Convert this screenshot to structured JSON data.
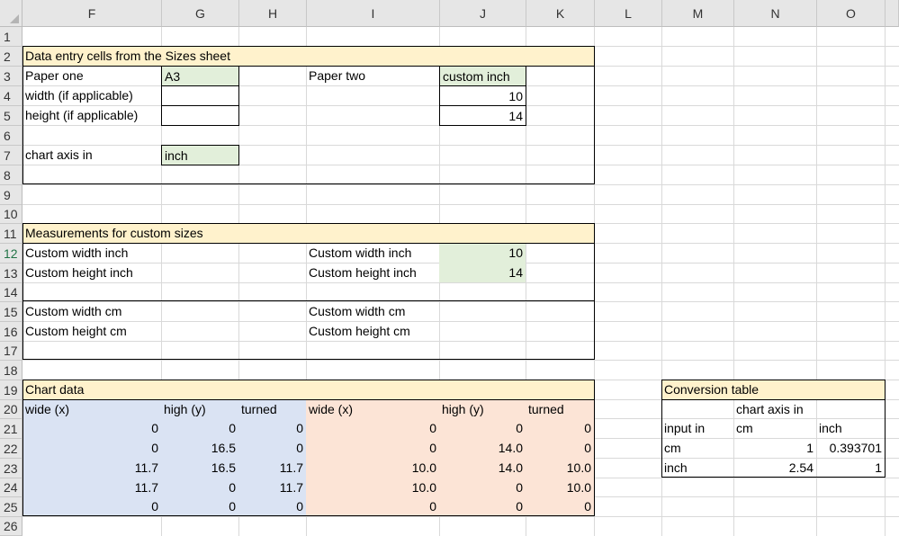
{
  "columns": [
    "F",
    "G",
    "H",
    "I",
    "J",
    "K",
    "L",
    "M",
    "N",
    "O"
  ],
  "rows": [
    "1",
    "2",
    "3",
    "4",
    "5",
    "6",
    "7",
    "8",
    "9",
    "10",
    "11",
    "12",
    "13",
    "14",
    "15",
    "16",
    "17",
    "18",
    "19",
    "20",
    "21",
    "22",
    "23",
    "24",
    "25",
    "26"
  ],
  "colors": {
    "yellow": "#fff2cc",
    "green": "#e2efda",
    "blue": "#dae3f3",
    "orange": "#fce4d6",
    "selected_row_header": "#217346"
  },
  "section_data_entry": {
    "title": "Data entry cells from the Sizes sheet",
    "paper_one_label": "Paper one",
    "paper_one_value": "A3",
    "width_label": "width (if applicable)",
    "height_label": "height (if applicable)",
    "paper_one_width": "",
    "paper_one_height": "",
    "paper_two_label": "Paper two",
    "paper_two_value": "custom inch",
    "paper_two_width": "10",
    "paper_two_height": "14",
    "chart_axis_label": "chart axis in",
    "chart_axis_value": "inch"
  },
  "section_measurements": {
    "title": "Measurements for custom sizes",
    "left": {
      "custom_width_inch": "Custom width inch",
      "custom_height_inch": "Custom height inch",
      "custom_width_cm": "Custom width cm",
      "custom_height_cm": "Custom height cm"
    },
    "right": {
      "custom_width_inch": "Custom width inch",
      "custom_width_inch_value": "10",
      "custom_height_inch": "Custom height inch",
      "custom_height_inch_value": "14",
      "custom_width_cm": "Custom width cm",
      "custom_height_cm": "Custom height cm"
    }
  },
  "section_chart_data": {
    "title": "Chart data",
    "headers": [
      "wide (x)",
      "high (y)",
      "turned",
      "wide (x)",
      "high (y)",
      "turned"
    ],
    "rows": [
      [
        "0",
        "0",
        "0",
        "0",
        "0",
        "0"
      ],
      [
        "0",
        "16.5",
        "0",
        "0",
        "14.0",
        "0"
      ],
      [
        "11.7",
        "16.5",
        "11.7",
        "10.0",
        "14.0",
        "10.0"
      ],
      [
        "11.7",
        "0",
        "11.7",
        "10.0",
        "0",
        "10.0"
      ],
      [
        "0",
        "0",
        "0",
        "0",
        "0",
        "0"
      ]
    ]
  },
  "conversion_table": {
    "title": "Conversion table",
    "chart_axis_in": "chart axis in",
    "input_in": "input in",
    "col_cm": "cm",
    "col_inch": "inch",
    "row_cm_label": "cm",
    "row_cm_cm": "1",
    "row_cm_inch": "0.393701",
    "row_inch_label": "inch",
    "row_inch_cm": "2.54",
    "row_inch_inch": "1"
  }
}
